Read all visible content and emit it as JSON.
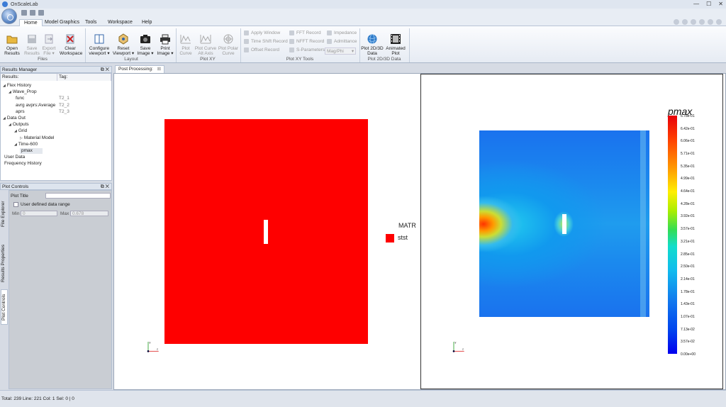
{
  "window": {
    "title": "OnScaleLab"
  },
  "tabs": [
    "Home",
    "Model Graphics",
    "Tools",
    "Workspace",
    "Help"
  ],
  "ribbon": {
    "files": {
      "label": "Files",
      "open": "Open\nResults",
      "save": "Save\nResults",
      "export": "Export\nFile ▾",
      "clear": "Clear\nWorkspace"
    },
    "layout": {
      "label": "Layout",
      "configure": "Configure\nviewport ▾",
      "reset": "Reset\nViewport ▾",
      "save_image": "Save\nImage ▾",
      "print_image": "Print\nImage ▾"
    },
    "plot_xy": {
      "label": "Plot XY",
      "plot_curve": "Plot\nCurve",
      "plot_curve_alt": "Plot Curve\nAlt Axis",
      "plot_polar": "Plot Polar\nCurve"
    },
    "plot_xy_tools": {
      "label": "Plot XY Tools",
      "apply_window": "Apply Window",
      "time_shift": "Time Shift Record",
      "offset": "Offset Record",
      "fft": "FFT Record",
      "nfft": "NFFT Record",
      "s_params": "S-Parameters",
      "impedance": "Impedance",
      "admittance": "Admittance",
      "mag_phi": "Mag/Phi"
    },
    "plot_2d3d": {
      "label": "Plot 2D/3D Data",
      "plot_data": "Plot 2D/3D\nData",
      "animated": "Animated\nPlot"
    }
  },
  "results_manager": {
    "title": "Results Manager",
    "col_results": "Results:",
    "col_tag": "Tag:",
    "tree": [
      {
        "label": "Flex History",
        "indent": 0,
        "arrow": "◢",
        "tag": ""
      },
      {
        "label": "Wave_Prop",
        "indent": 1,
        "arrow": "◢",
        "tag": ""
      },
      {
        "label": "func",
        "indent": 2,
        "arrow": "",
        "tag": "T2_1"
      },
      {
        "label": "avrg avprs:Average",
        "indent": 2,
        "arrow": "",
        "tag": "T2_2"
      },
      {
        "label": "aprs",
        "indent": 2,
        "arrow": "",
        "tag": "T2_3"
      },
      {
        "label": "Data Out",
        "indent": 0,
        "arrow": "◢",
        "tag": ""
      },
      {
        "label": "Outputs",
        "indent": 1,
        "arrow": "◢",
        "tag": ""
      },
      {
        "label": "Grid",
        "indent": 2,
        "arrow": "◢",
        "tag": ""
      },
      {
        "label": "Material Model",
        "indent": 3,
        "arrow": "▷",
        "tag": ""
      },
      {
        "label": "Time-600",
        "indent": 2,
        "arrow": "◢",
        "tag": ""
      },
      {
        "label": "pmax",
        "indent": 3,
        "arrow": "",
        "tag": ""
      },
      {
        "label": "User Data",
        "indent": 0,
        "arrow": "",
        "tag": ""
      },
      {
        "label": "Frequency History",
        "indent": 0,
        "arrow": "",
        "tag": ""
      }
    ]
  },
  "plot_controls": {
    "title": "Plot Controls",
    "plot_title_label": "Plot Title",
    "plot_title_value": "",
    "user_range_label": "User defined data range",
    "min_label": "Min",
    "min_value": "0",
    "max_label": "Max",
    "max_value": "0.678"
  },
  "side_tabs": [
    "File Explorer",
    "Results Properties",
    "Plot Controls"
  ],
  "document_tab": "Post Processing:",
  "left_view": {
    "legend_title": "MATR",
    "legend_item": "stst",
    "legend_color": "#fe0000",
    "axis_y": "y",
    "axis_z": "z"
  },
  "right_view": {
    "colorbar_title": "pmax",
    "ticks": [
      "6.78e-01",
      "6.42e-01",
      "6.06e-01",
      "5.71e-01",
      "5.35e-01",
      "4.99e-01",
      "4.64e-01",
      "4.28e-01",
      "3.92e-01",
      "3.57e-01",
      "3.21e-01",
      "2.85e-01",
      "2.50e-01",
      "2.14e-01",
      "1.78e-01",
      "1.43e-01",
      "1.07e-01",
      "7.13e-02",
      "3.57e-02",
      "0.00e+00"
    ],
    "axis_y": "y",
    "axis_z": "z"
  },
  "status": {
    "text": "Total: 239  Line: 221  Col: 1  Sel: 0 | 0"
  }
}
